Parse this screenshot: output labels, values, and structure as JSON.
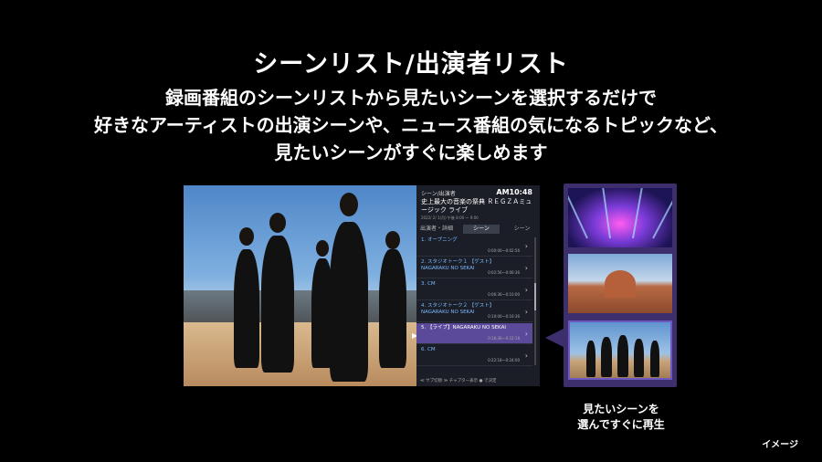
{
  "slide": {
    "title": "シーンリスト/出演者リスト",
    "subtitle_lines": [
      "録画番組のシーンリストから見たいシーンを選択するだけで",
      "好きなアーティストの出演シーンや、ニュース番組の気になるトピックなど、",
      "見たいシーンがすぐに楽しめます"
    ],
    "caption_lines": [
      "見たいシーンを",
      "選んですぐに再生"
    ],
    "note": "イメージ"
  },
  "tv_panel": {
    "header": "シーン/出演者",
    "clock": "AM10:48",
    "program_title": "史上最大の音楽の祭典 ＲＥＧＺＡミュージック ライブ",
    "program_date": "2022/ 2/ 1(月) 午後 8:00 ～ 9:00",
    "tabs": [
      "出演者・詳細",
      "シーン",
      "シーン"
    ],
    "scenes": [
      {
        "label": "1. オープニング",
        "time": "0:00:00〜0:02:56"
      },
      {
        "label": "2. スタジオトーク１ 【ゲスト】NAGARAKU NO SEKAI",
        "time": "0:02:56〜0:06:36"
      },
      {
        "label": "3. CM",
        "time": "0:06:36〜0:10:00"
      },
      {
        "label": "4. スタジオトーク２ 【ゲスト】NAGARAKU NO SEKAI",
        "time": "0:10:00〜0:16:36"
      },
      {
        "label": "5. 【ライブ】NAGARAKU NO SEKAI",
        "time": "0:16:36〜0:22:18"
      },
      {
        "label": "6. CM",
        "time": "0:22:18〜0:24:00"
      }
    ],
    "footer": "≪ サブ切替 ≫ チャプター表示 ● で決定"
  },
  "colors": {
    "accent": "#3d2f6e",
    "selected_row": "#5b4a9a",
    "link_text": "#7ab8ff"
  },
  "thumbnails": [
    "concert-stage",
    "cathedral-dome",
    "artists-group"
  ]
}
